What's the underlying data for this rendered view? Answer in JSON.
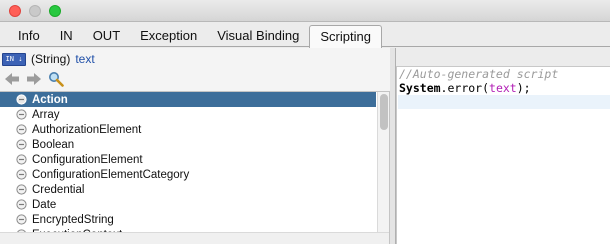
{
  "window": {
    "traffic_lights": [
      "close",
      "minimize",
      "maximize"
    ]
  },
  "tabs": [
    {
      "label": "Info",
      "active": false
    },
    {
      "label": "IN",
      "active": false
    },
    {
      "label": "OUT",
      "active": false
    },
    {
      "label": "Exception",
      "active": false
    },
    {
      "label": "Visual Binding",
      "active": false
    },
    {
      "label": "Scripting",
      "active": true
    }
  ],
  "type_info": {
    "badge": "IN ⇣",
    "kind": "(String)",
    "name": "text"
  },
  "nav": {
    "back_icon": "arrow-left-icon",
    "forward_icon": "arrow-right-icon",
    "search_icon": "magnifier-icon"
  },
  "object_list": {
    "items": [
      {
        "label": "Action",
        "selected": true
      },
      {
        "label": "Array",
        "selected": false
      },
      {
        "label": "AuthorizationElement",
        "selected": false
      },
      {
        "label": "Boolean",
        "selected": false
      },
      {
        "label": "ConfigurationElement",
        "selected": false
      },
      {
        "label": "ConfigurationElementCategory",
        "selected": false
      },
      {
        "label": "Credential",
        "selected": false
      },
      {
        "label": "Date",
        "selected": false
      },
      {
        "label": "EncryptedString",
        "selected": false
      },
      {
        "label": "ExecutionContext",
        "selected": false
      }
    ],
    "item_icon": "type-circle-icon",
    "scroll_position": 0.0
  },
  "editor": {
    "comment": "//Auto-generated script",
    "code_object": "System",
    "code_method": ".error(",
    "code_arg": "text",
    "code_end": ");"
  },
  "colors": {
    "selection": "#3d6e9a",
    "string_var": "#b21fb5",
    "comment": "#9a9a9a",
    "type_name": "#2050a8"
  }
}
